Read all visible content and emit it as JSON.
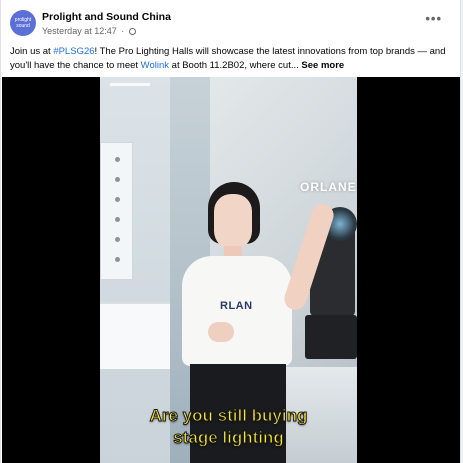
{
  "post": {
    "page_name": "Prolight and Sound China",
    "avatar_text": "prolight sound",
    "timestamp": "Yesterday at 12:47",
    "separator": "·",
    "more_menu_label": "•••",
    "text": {
      "part1": "Join us at ",
      "hashtag": "#PLSG26",
      "part2": "! The Pro Lighting Halls will showcase the latest innovations from top brands — and you'll have the chance to meet ",
      "mention": "Wolink",
      "part3": "  at Booth 11.2B02, where cut... ",
      "see_more": "See more"
    }
  },
  "video": {
    "sign_text": "ORLANE",
    "shirt_text": "RLAN",
    "caption_line1": "Are you still buying",
    "caption_line2": "stage lighting"
  },
  "colors": {
    "link": "#216fdb",
    "caption": "#f7e535",
    "avatar_bg": "#5b6fd6"
  }
}
